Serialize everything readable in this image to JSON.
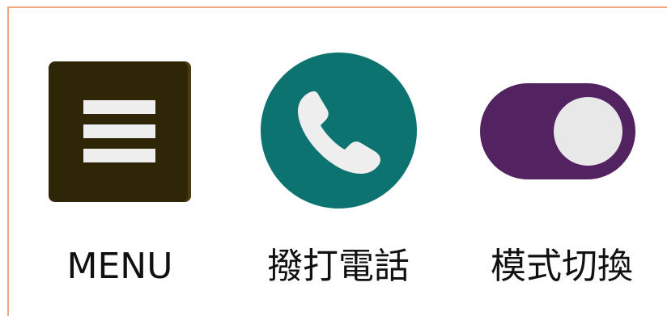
{
  "buttons": {
    "menu": {
      "label": "MENU",
      "icon": "hamburger-menu-icon",
      "color": "#2f2608"
    },
    "call": {
      "label": "撥打電話",
      "icon": "phone-icon",
      "color": "#0c7370"
    },
    "mode": {
      "label": "模式切換",
      "icon": "toggle-switch-icon",
      "color": "#532261"
    }
  },
  "colors": {
    "frame_border": "#f0a878",
    "icon_foreground": "#eeeeee"
  }
}
